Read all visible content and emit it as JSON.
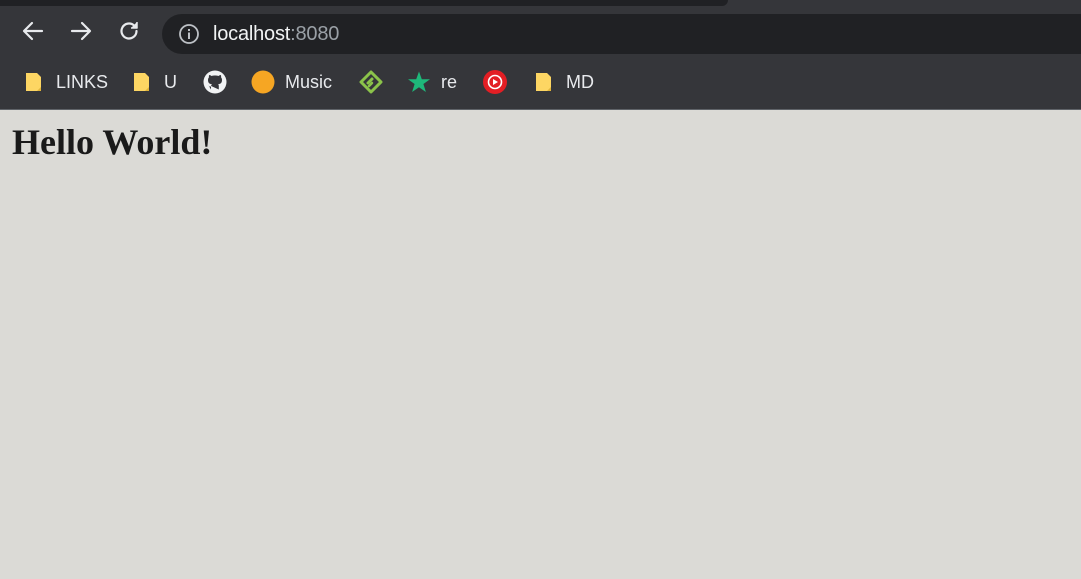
{
  "browser": {
    "url_host": "localhost",
    "url_port": ":8080"
  },
  "toolbar": {
    "back_icon": "arrow-left-icon",
    "forward_icon": "arrow-right-icon",
    "reload_icon": "reload-icon",
    "info_icon": "info-circle-icon"
  },
  "bookmarks": [
    {
      "label": "LINKS",
      "icon": "folder-icon"
    },
    {
      "label": "U",
      "icon": "folder-icon"
    },
    {
      "label": "",
      "icon": "github-icon"
    },
    {
      "label": "Music",
      "icon": "orange-circle-icon"
    },
    {
      "label": "",
      "icon": "feedly-icon"
    },
    {
      "label": "re",
      "icon": "green-star-icon"
    },
    {
      "label": "",
      "icon": "youtube-music-icon"
    },
    {
      "label": "MD",
      "icon": "folder-icon"
    }
  ],
  "page": {
    "heading": "Hello World!"
  },
  "colors": {
    "chrome_bg": "#35363a",
    "omnibox_bg": "#202124",
    "page_bg": "#dbdad6",
    "folder": "#fdd663",
    "music_orange": "#f6a623",
    "feedly_green": "#8bc34a",
    "star_green": "#1eb87a",
    "youtube_red": "#e31e24"
  }
}
